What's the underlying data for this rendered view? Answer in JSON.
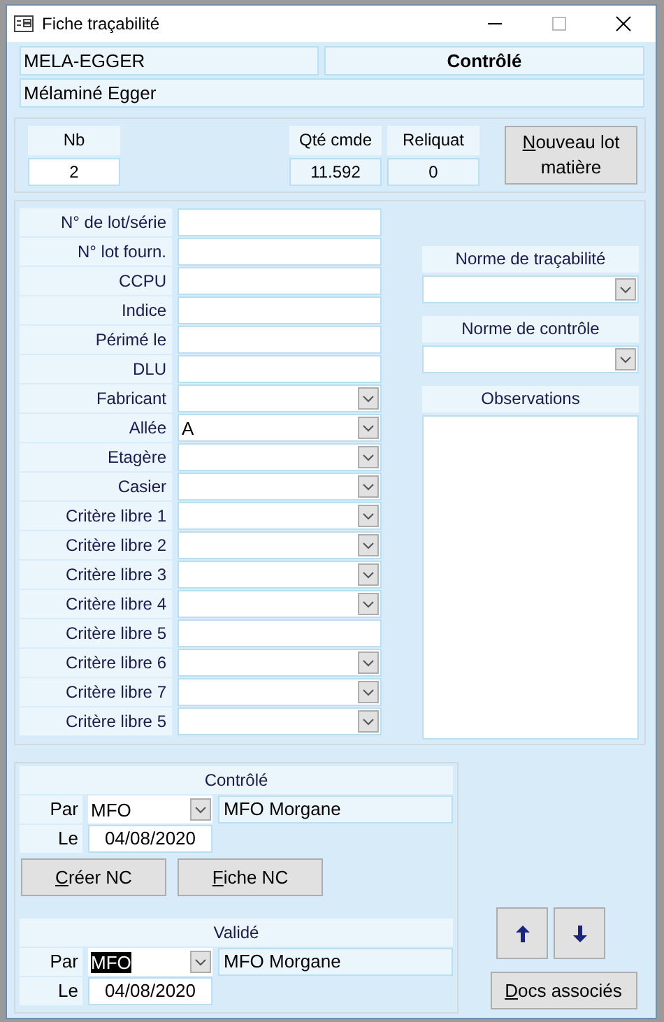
{
  "window": {
    "title": "Fiche traçabilité"
  },
  "header": {
    "code": "MELA-EGGER",
    "status": "Contrôlé",
    "designation": "Mélaminé Egger"
  },
  "quantities": {
    "nb_label": "Nb",
    "nb": "2",
    "qte_label": "Qté cmde",
    "qte": "11.592",
    "reliquat_label": "Reliquat",
    "reliquat": "0"
  },
  "new_lot_button": "Nouveau lot matière",
  "fields": [
    {
      "label": "N° de lot/série",
      "kind": "text"
    },
    {
      "label": "N° lot fourn.",
      "kind": "text"
    },
    {
      "label": "CCPU",
      "kind": "text"
    },
    {
      "label": "Indice",
      "kind": "text"
    },
    {
      "label": "Périmé le",
      "kind": "text"
    },
    {
      "label": "DLU",
      "kind": "text"
    },
    {
      "label": "Fabricant",
      "kind": "combo"
    },
    {
      "label": "Allée",
      "kind": "combo",
      "value": "A"
    },
    {
      "label": "Etagère",
      "kind": "combo"
    },
    {
      "label": "Casier",
      "kind": "combo"
    },
    {
      "label": "Critère libre 1",
      "kind": "combo"
    },
    {
      "label": "Critère libre 2",
      "kind": "combo"
    },
    {
      "label": "Critère libre 3",
      "kind": "combo"
    },
    {
      "label": "Critère libre 4",
      "kind": "combo"
    },
    {
      "label": "Critère libre 5",
      "kind": "text"
    },
    {
      "label": "Critère libre 6",
      "kind": "combo"
    },
    {
      "label": "Critère libre 7",
      "kind": "combo"
    },
    {
      "label": "Critère libre 5",
      "kind": "combo"
    }
  ],
  "norms": [
    {
      "label": "Norme de traçabilité"
    },
    {
      "label": "Norme de contrôle"
    }
  ],
  "observations": {
    "label": "Observations"
  },
  "controle": {
    "title": "Contrôlé",
    "par_label": "Par",
    "par": "MFO",
    "text_selected": false,
    "name": "MFO Morgane",
    "le_label": "Le",
    "date": "04/08/2020"
  },
  "nc_buttons": [
    "Créer NC",
    "Fiche NC"
  ],
  "valide": {
    "title": "Validé",
    "par_label": "Par",
    "par": "MFO",
    "text_selected": true,
    "name": "MFO Morgane",
    "le_label": "Le",
    "date": "04/08/2020"
  },
  "docs_button": "Docs associés"
}
